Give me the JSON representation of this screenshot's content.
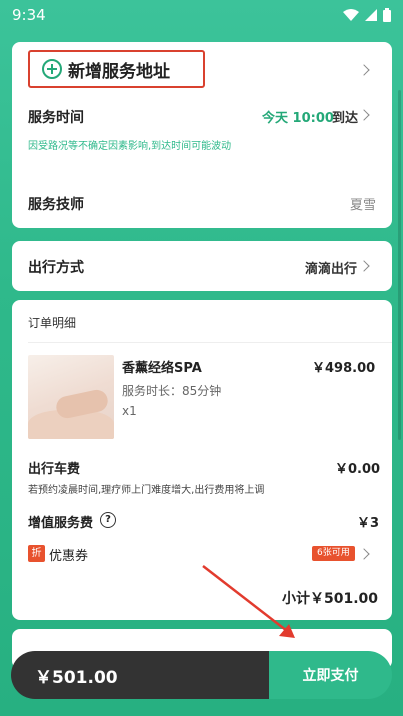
{
  "status_bar": {
    "time": "9:34"
  },
  "address": {
    "add_label": "新增服务地址",
    "time_label": "服务时间",
    "time_value": "今天 10:00",
    "arrive": "到达",
    "hint": "因受路况等不确定因素影响,到达时间可能波动"
  },
  "technician": {
    "label": "服务技师",
    "value": "夏雪"
  },
  "travel": {
    "label": "出行方式",
    "value": "滴滴出行"
  },
  "order": {
    "title": "订单明细",
    "service_name": "香薰经络SPA",
    "service_price": "￥498.00",
    "duration": "服务时长：85分钟",
    "qty": "x1",
    "travel_fee_label": "出行车费",
    "travel_fee_value": "￥0.00",
    "travel_fee_note": "若预约凌晨时间,理疗师上门难度增大,出行费用将上调",
    "extra_label": "增值服务费",
    "extra_value": "￥3",
    "coupon_tag": "折",
    "coupon_label": "优惠券",
    "coupon_badge": "6张可用",
    "subtotal": "小计￥501.00"
  },
  "bottom": {
    "total": "￥501.00",
    "pay_label": "立即支付"
  },
  "colors": {
    "primary": "#2fb98b",
    "highlight": "#d9412f",
    "coupon": "#e8522e"
  }
}
